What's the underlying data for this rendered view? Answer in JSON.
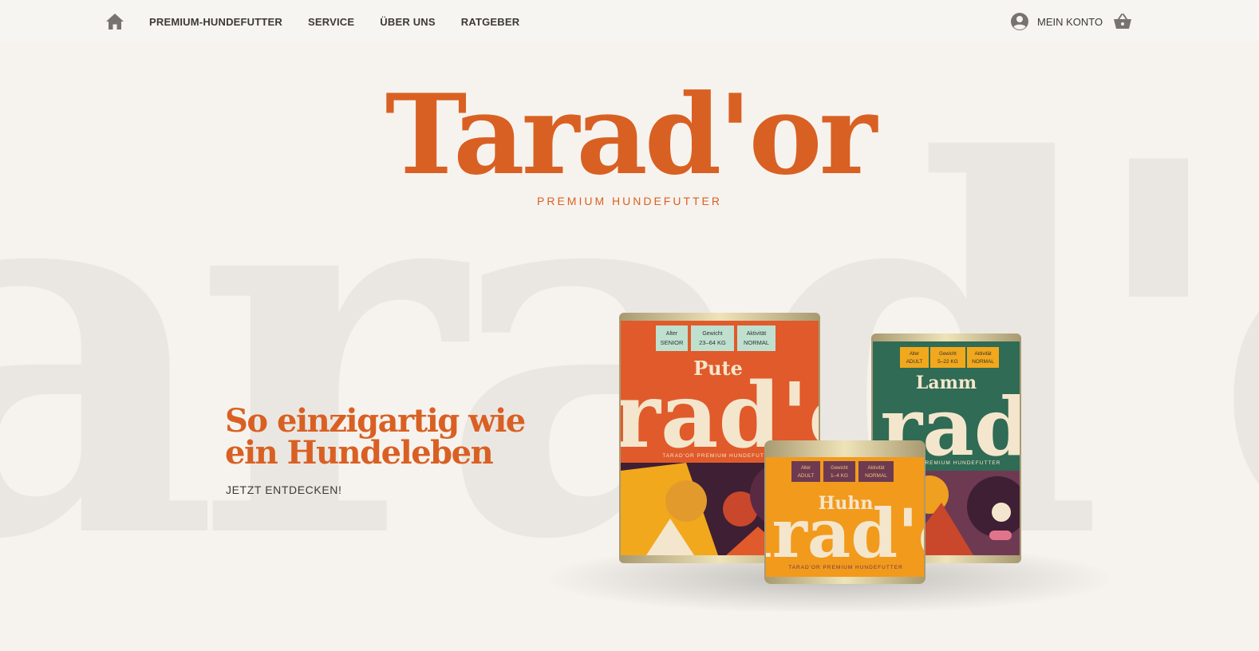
{
  "background": {
    "text": "arad'o"
  },
  "nav": {
    "home_icon": "home-icon",
    "items": [
      {
        "label": "PREMIUM-HUNDEFUTTER"
      },
      {
        "label": "SERVICE"
      },
      {
        "label": "ÜBER UNS"
      },
      {
        "label": "RATGEBER"
      }
    ],
    "account_icon": "account-circle-icon",
    "account_label": "MEIN KONTO",
    "cart_icon": "shopping-basket-icon"
  },
  "logo": {
    "wordmark": "Tarad'or",
    "tagline": "PREMIUM HUNDEFUTTER"
  },
  "hero": {
    "headline": "So einzigartig wie ein Hundeleben",
    "cta_label": "JETZT ENTDECKEN!"
  },
  "products": [
    {
      "flavor": "Pute",
      "brand": "arad'o",
      "subline": "TARAD'OR PREMIUM HUNDEFUTTER",
      "tags": [
        {
          "key": "Alter",
          "value": "SENIOR"
        },
        {
          "key": "Gewicht",
          "value": "23–64 KG"
        },
        {
          "key": "Aktivität",
          "value": "NORMAL"
        }
      ],
      "color": "#e05a2b"
    },
    {
      "flavor": "Lamm",
      "brand": "arad'",
      "subline": "N PREMIUM HUNDEFUTTER",
      "tags": [
        {
          "key": "Alter",
          "value": "ADULT"
        },
        {
          "key": "Gewicht",
          "value": "5–22 KG"
        },
        {
          "key": "Aktivität",
          "value": "NORMAL"
        }
      ],
      "color": "#2f6b55"
    },
    {
      "flavor": "Huhn",
      "brand": "arad'o",
      "subline": "TARAD'OR PREMIUM HUNDEFUTTER",
      "tags": [
        {
          "key": "Alter",
          "value": "ADULT"
        },
        {
          "key": "Gewicht",
          "value": "1–4 KG"
        },
        {
          "key": "Aktivität",
          "value": "NORMAL"
        }
      ],
      "color": "#f29a1c"
    }
  ],
  "colors": {
    "brand": "#d96023",
    "background": "#f6f3ee",
    "text": "#3d3a36"
  }
}
